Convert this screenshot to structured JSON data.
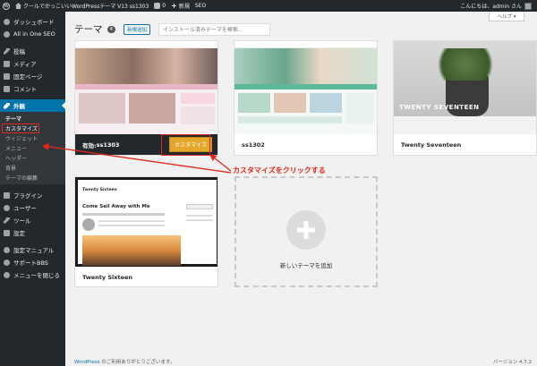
{
  "admin_bar": {
    "site_name": "クールでかっこいいWordPressテーマ V13 ss1303",
    "comments_count": "0",
    "new_label": "新規",
    "seo_label": "SEO",
    "greeting": "こんにちは、admin さん"
  },
  "sidebar": {
    "items": [
      {
        "label": "ダッシュボード",
        "icon": "dashboard-icon"
      },
      {
        "label": "All in One SEO",
        "icon": "seo-icon"
      },
      {
        "label": "投稿",
        "icon": "pin-icon"
      },
      {
        "label": "メディア",
        "icon": "media-icon"
      },
      {
        "label": "固定ページ",
        "icon": "pages-icon"
      },
      {
        "label": "コメント",
        "icon": "comments-icon"
      },
      {
        "label": "外観",
        "icon": "appearance-icon"
      },
      {
        "label": "プラグイン",
        "icon": "plugins-icon"
      },
      {
        "label": "ユーザー",
        "icon": "users-icon"
      },
      {
        "label": "ツール",
        "icon": "tools-icon"
      },
      {
        "label": "設定",
        "icon": "settings-icon"
      },
      {
        "label": "設定マニュアル",
        "icon": "manual-icon"
      },
      {
        "label": "サポートBBS",
        "icon": "support-icon"
      },
      {
        "label": "メニューを閉じる",
        "icon": "collapse-icon"
      }
    ],
    "submenu": [
      "テーマ",
      "カスタマイズ",
      "ウィジェット",
      "メニュー",
      "ヘッダー",
      "背景",
      "テーマの編集"
    ]
  },
  "page": {
    "title": "テーマ",
    "count": "4",
    "add_new": "新規追加",
    "search_placeholder": "インストール済みテーマを検索...",
    "help": "ヘルプ ▾"
  },
  "themes": [
    {
      "name": "ss1303",
      "active_prefix": "有効: ",
      "customize": "カスタマイズ"
    },
    {
      "name": "ss1302"
    },
    {
      "name": "Twenty Seventeen",
      "overlay": "TWENTY SEVENTEEN"
    },
    {
      "name": "Twenty Sixteen",
      "preview_title": "Twenty Sixteen",
      "preview_heading": "Come Sail Away with Me"
    }
  ],
  "add_new_theme": "新しいテーマを追加",
  "annotation": "カスタマイズをクリックする",
  "annotation_color": "#e2271d",
  "footer": {
    "link": "WordPress",
    "text": " のご利用ありがとうございます。",
    "version": "バージョン 4.7.2"
  }
}
